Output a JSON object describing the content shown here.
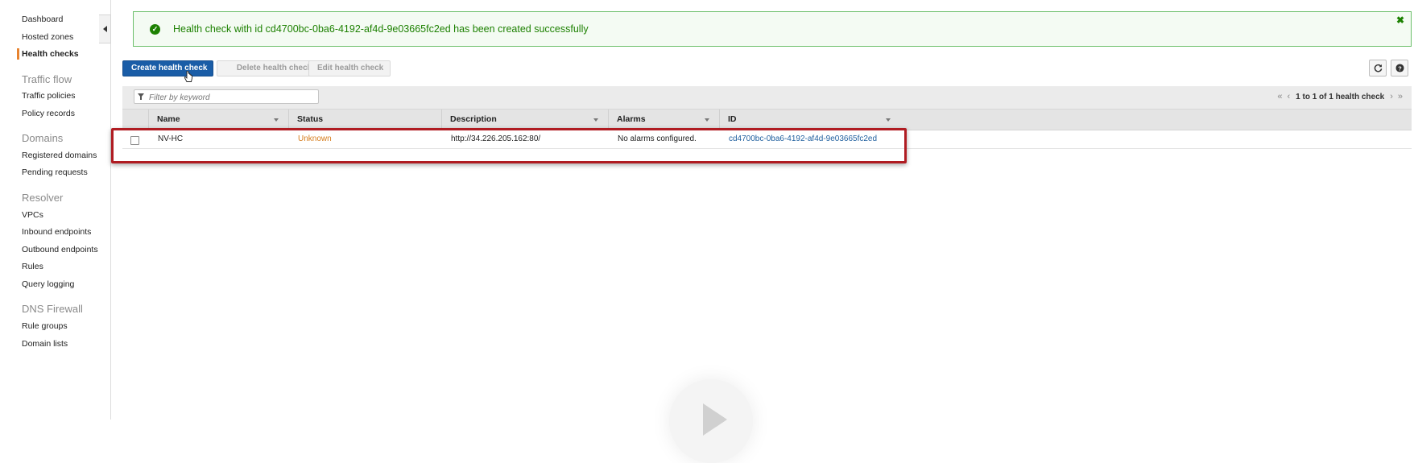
{
  "sidebar": {
    "items": [
      {
        "label": "Dashboard",
        "active": false
      },
      {
        "label": "Hosted zones",
        "active": false
      },
      {
        "label": "Health checks",
        "active": true
      }
    ],
    "sections": [
      {
        "title": "Traffic flow",
        "items": [
          "Traffic policies",
          "Policy records"
        ]
      },
      {
        "title": "Domains",
        "items": [
          "Registered domains",
          "Pending requests"
        ]
      },
      {
        "title": "Resolver",
        "items": [
          "VPCs",
          "Inbound endpoints",
          "Outbound endpoints",
          "Rules",
          "Query logging"
        ]
      },
      {
        "title": "DNS Firewall",
        "items": [
          "Rule groups",
          "Domain lists"
        ]
      }
    ]
  },
  "flash": {
    "message": "Health check with id cd4700bc-0ba6-4192-af4d-9e03665fc2ed has been created successfully",
    "icon": "check-circle-icon",
    "close": "✖"
  },
  "toolbar": {
    "create_label": "Create health check",
    "delete_label": "Delete health check",
    "edit_label": "Edit health check",
    "refresh_icon": "refresh-icon",
    "help_icon": "help-icon"
  },
  "filter": {
    "placeholder": "Filter by keyword",
    "pager_text": "1 to 1 of 1 health check"
  },
  "table": {
    "columns": [
      "Name",
      "Status",
      "Description",
      "Alarms",
      "ID"
    ],
    "rows": [
      {
        "name": "NV-HC",
        "status": "Unknown",
        "description": "http://34.226.205.162:80/",
        "alarms": "No alarms configured.",
        "id": "cd4700bc-0ba6-4192-af4d-9e03665fc2ed"
      }
    ]
  },
  "colors": {
    "accent": "#1a5da7",
    "success": "#1d8102",
    "status_unknown": "#d67c1c",
    "highlight": "#b01c22"
  }
}
